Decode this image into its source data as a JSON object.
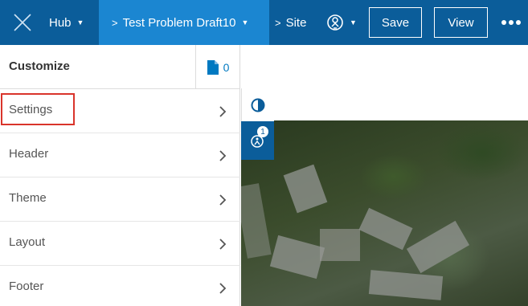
{
  "topbar": {
    "hub_label": "Hub",
    "draft_label": "Test Problem Draft10",
    "site_label": "Site",
    "save_label": "Save",
    "view_label": "View",
    "colors": {
      "bar": "#0b5d9a",
      "active": "#1b86d1"
    }
  },
  "panel": {
    "title": "Customize",
    "page_count": "0",
    "items": [
      {
        "label": "Settings"
      },
      {
        "label": "Header"
      },
      {
        "label": "Theme"
      },
      {
        "label": "Layout"
      },
      {
        "label": "Footer"
      }
    ]
  },
  "tools": {
    "a11y_badge": "1"
  },
  "highlight_color": "#d9342b"
}
